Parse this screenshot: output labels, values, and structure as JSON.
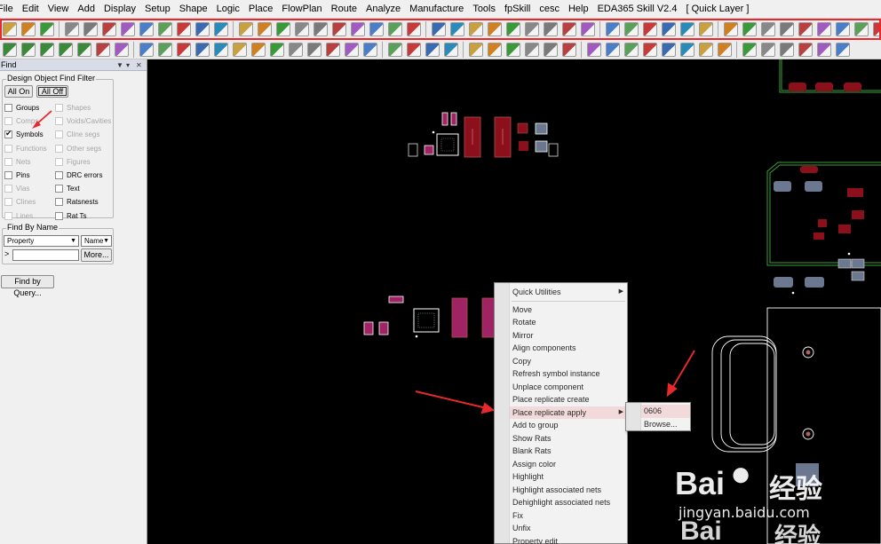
{
  "menubar": {
    "items": [
      "File",
      "Edit",
      "View",
      "Add",
      "Display",
      "Setup",
      "Shape",
      "Logic",
      "Place",
      "FlowPlan",
      "Route",
      "Analyze",
      "Manufacture",
      "Tools",
      "fpSkill",
      "cesc",
      "Help",
      "EDA365 Skill V2.4",
      "[ Quick Layer ]"
    ]
  },
  "find_panel": {
    "title": "Find",
    "filter_group_label": "Design Object Find Filter",
    "all_on_label": "All On",
    "all_off_label": "All Off",
    "filters": [
      {
        "label": "Groups",
        "checked": false,
        "enabled": true
      },
      {
        "label": "Shapes",
        "checked": false,
        "enabled": false
      },
      {
        "label": "Comps",
        "checked": false,
        "enabled": false
      },
      {
        "label": "Voids/Cavities",
        "checked": false,
        "enabled": false
      },
      {
        "label": "Symbols",
        "checked": true,
        "enabled": true
      },
      {
        "label": "Cline segs",
        "checked": false,
        "enabled": false
      },
      {
        "label": "Functions",
        "checked": false,
        "enabled": false
      },
      {
        "label": "Other segs",
        "checked": false,
        "enabled": false
      },
      {
        "label": "Nets",
        "checked": false,
        "enabled": false
      },
      {
        "label": "Figures",
        "checked": false,
        "enabled": false
      },
      {
        "label": "Pins",
        "checked": false,
        "enabled": true
      },
      {
        "label": "DRC errors",
        "checked": false,
        "enabled": true
      },
      {
        "label": "Vias",
        "checked": false,
        "enabled": false
      },
      {
        "label": "Text",
        "checked": false,
        "enabled": true
      },
      {
        "label": "Clines",
        "checked": false,
        "enabled": false
      },
      {
        "label": "Ratsnests",
        "checked": false,
        "enabled": true
      },
      {
        "label": "Lines",
        "checked": false,
        "enabled": false
      },
      {
        "label": "Rat Ts",
        "checked": false,
        "enabled": true
      }
    ],
    "find_by_name_label": "Find By Name",
    "property_select": "Property",
    "name_select": "Name",
    "name_prefix": ">",
    "more_label": "More...",
    "find_by_query_label": "Find by Query..."
  },
  "context_menu": {
    "items": [
      {
        "label": "Quick Utilities",
        "submenu": true
      },
      {
        "label": "Move"
      },
      {
        "label": "Rotate"
      },
      {
        "label": "Mirror"
      },
      {
        "label": "Align components"
      },
      {
        "label": "Copy"
      },
      {
        "label": "Refresh symbol instance"
      },
      {
        "label": "Unplace component"
      },
      {
        "label": "Place replicate create"
      },
      {
        "label": "Place replicate apply",
        "submenu": true,
        "highlighted": true
      },
      {
        "label": "Add to group"
      },
      {
        "label": "Show Rats"
      },
      {
        "label": "Blank Rats"
      },
      {
        "label": "Assign color"
      },
      {
        "label": "Highlight"
      },
      {
        "label": "Highlight associated nets"
      },
      {
        "label": "Dehighlight associated nets"
      },
      {
        "label": "Fix"
      },
      {
        "label": "Unfix"
      },
      {
        "label": "Property edit"
      }
    ]
  },
  "submenu": {
    "items": [
      {
        "label": "0606",
        "highlighted": true
      },
      {
        "label": "Browse..."
      }
    ]
  },
  "watermark": {
    "brand_left": "Bai",
    "brand_right": "经验",
    "url": "jingyan.baidu.com"
  },
  "colors": {
    "menu_highlight": "#f3dada",
    "annotation_red": "#e8292c",
    "board_outline": "#3da03d",
    "pad_magenta": "#a02363",
    "pad_darkred": "#8c0f1c",
    "pad_gray_blue": "#6c7890"
  }
}
